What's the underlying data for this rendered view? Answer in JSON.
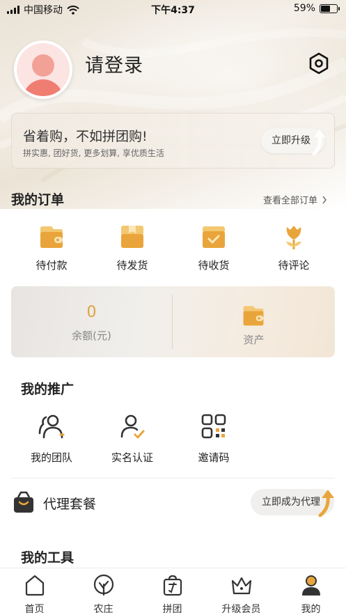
{
  "status_bar": {
    "carrier": "中国移动",
    "time": "下午4:37",
    "battery": "59%",
    "battery_level": 0.59
  },
  "profile": {
    "login_text": "请登录",
    "settings_icon": "hexagon-gear-icon"
  },
  "vip_banner": {
    "title": "省着购，不如拼团购!",
    "subtitle": "拼实惠, 团好货, 更多划算, 享优质生活",
    "button": "立即升级"
  },
  "orders": {
    "title": "我的订单",
    "see_all": "查看全部订单",
    "items": [
      {
        "label": "待付款",
        "icon": "wallet-icon"
      },
      {
        "label": "待发货",
        "icon": "box-icon"
      },
      {
        "label": "待收货",
        "icon": "delivery-box-icon"
      },
      {
        "label": "待评论",
        "icon": "tulip-icon"
      }
    ]
  },
  "assets": {
    "balance_value": "0",
    "balance_label": "余额(元)",
    "asset_label": "资产",
    "asset_icon": "wallet-icon"
  },
  "promotion": {
    "title": "我的推广",
    "items": [
      {
        "label": "我的团队",
        "icon": "team-icon"
      },
      {
        "label": "实名认证",
        "icon": "user-check-icon"
      },
      {
        "label": "邀请码",
        "icon": "qr-code-icon"
      }
    ]
  },
  "agent": {
    "title": "代理套餐",
    "button": "立即成为代理",
    "icon": "bag-icon"
  },
  "tools": {
    "title": "我的工具"
  },
  "tabbar": {
    "items": [
      {
        "label": "首页",
        "icon": "home-icon"
      },
      {
        "label": "农庄",
        "icon": "tree-icon"
      },
      {
        "label": "拼团",
        "icon": "group-buy-icon"
      },
      {
        "label": "升级会员",
        "icon": "crown-icon"
      },
      {
        "label": "我的",
        "icon": "profile-icon",
        "active": true
      }
    ]
  },
  "colors": {
    "accent": "#e0a23b",
    "accent_light": "#f3c871"
  }
}
